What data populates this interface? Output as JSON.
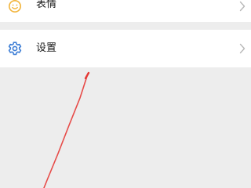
{
  "menu": {
    "items": [
      {
        "label": "表情",
        "icon": "emoji-icon",
        "icon_color": "#f2b43a"
      },
      {
        "label": "设置",
        "icon": "gear-icon",
        "icon_color": "#3f7fd6"
      }
    ]
  },
  "colors": {
    "background": "#ededed",
    "row": "#ffffff",
    "text": "#1a1a1a",
    "chevron": "#b8b8b8",
    "annotation": "#e53935"
  }
}
